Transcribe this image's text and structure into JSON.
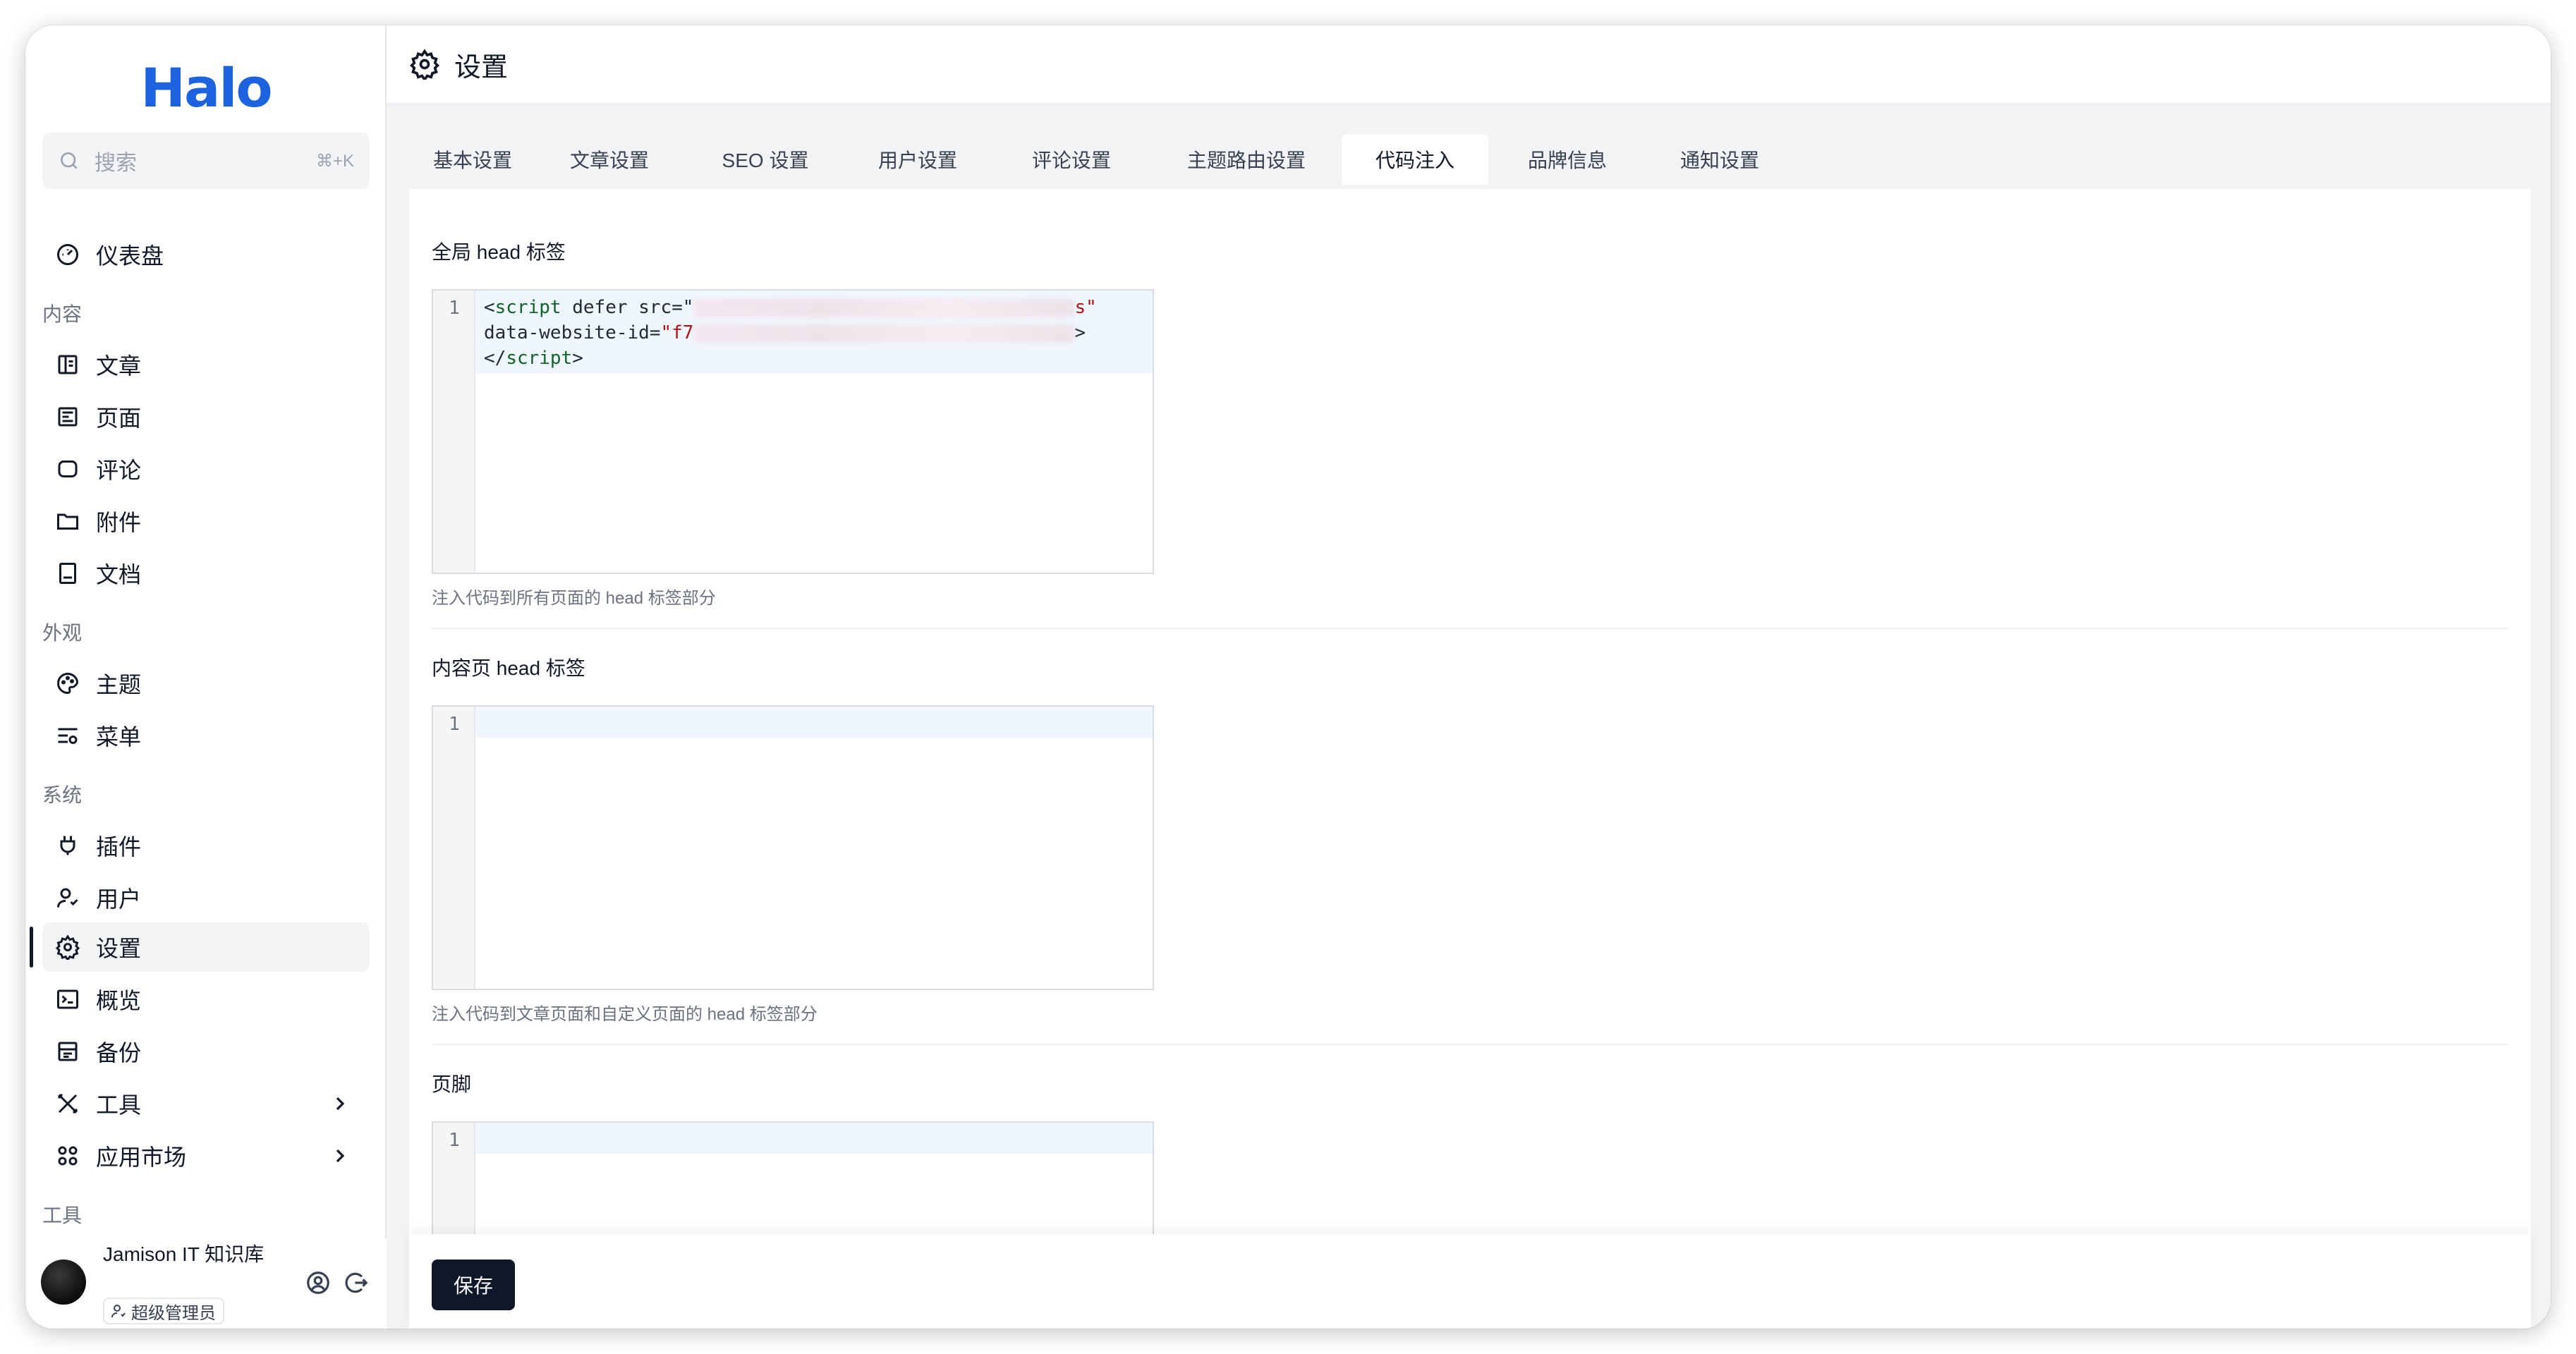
{
  "app": {
    "logo": "Halo"
  },
  "search": {
    "placeholder": "搜索",
    "shortcut": "⌘+K"
  },
  "nav": {
    "dashboard": "仪表盘",
    "section_content": "内容",
    "content": [
      "文章",
      "页面",
      "评论",
      "附件",
      "文档"
    ],
    "section_appearance": "外观",
    "appearance": [
      "主题",
      "菜单"
    ],
    "section_system": "系统",
    "system": [
      "插件",
      "用户",
      "设置",
      "概览",
      "备份",
      "工具",
      "应用市场"
    ],
    "section_tools": "工具"
  },
  "user": {
    "name": "Jamison IT 知识库",
    "role": "超级管理员"
  },
  "header": {
    "title": "设置"
  },
  "tabs": [
    "基本设置",
    "文章设置",
    "SEO 设置",
    "用户设置",
    "评论设置",
    "主题路由设置",
    "代码注入",
    "品牌信息",
    "通知设置"
  ],
  "active_tab": "代码注入",
  "fields": {
    "global_head": {
      "label": "全局 head 标签",
      "help": "注入代码到所有页面的 head 标签部分",
      "line_number": "1",
      "code": {
        "open_tag": "script",
        "attr_defer": "defer",
        "attr_src": "src=",
        "src_end": "s\"",
        "attr_data": "data-website-id=",
        "data_start": "\"f7",
        "close_angle": ">",
        "close_tag": "script"
      }
    },
    "content_head": {
      "label": "内容页 head 标签",
      "help": "注入代码到文章页面和自定义页面的 head 标签部分",
      "line_number": "1"
    },
    "footer": {
      "label": "页脚",
      "line_number": "1"
    }
  },
  "actions": {
    "save": "保存"
  },
  "colors": {
    "brand": "#1d63e0",
    "primary_button": "#0f172a"
  }
}
